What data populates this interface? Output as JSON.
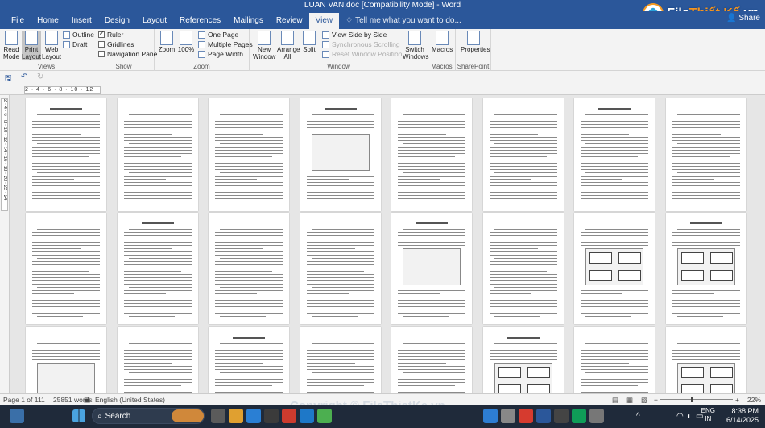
{
  "window": {
    "title": "LUAN VAN.doc [Compatibility Mode] - Word"
  },
  "brand": {
    "name_part1": "File",
    "name_part2": "Thiết Kế",
    "name_part3": ".vn"
  },
  "tabs": [
    "File",
    "Home",
    "Insert",
    "Design",
    "Layout",
    "References",
    "Mailings",
    "Review",
    "View"
  ],
  "tell_me": "Tell me what you want to do...",
  "share_label": "Share",
  "ribbon": {
    "views": {
      "group": "Views",
      "read_mode": "Read Mode",
      "print_layout": "Print Layout",
      "web_layout": "Web Layout",
      "outline": "Outline",
      "draft": "Draft"
    },
    "show": {
      "group": "Show",
      "ruler": "Ruler",
      "gridlines": "Gridlines",
      "nav_pane": "Navigation Pane",
      "ruler_checked": true,
      "gridlines_checked": false,
      "nav_checked": false
    },
    "zoom": {
      "group": "Zoom",
      "zoom": "Zoom",
      "hundred": "100%",
      "one_page": "One Page",
      "multiple_pages": "Multiple Pages",
      "page_width": "Page Width"
    },
    "window": {
      "group": "Window",
      "new_window": "New Window",
      "arrange_all": "Arrange All",
      "split": "Split",
      "side_by_side": "View Side by Side",
      "sync_scroll": "Synchronous Scrolling",
      "reset_pos": "Reset Window Position",
      "switch_windows": "Switch Windows"
    },
    "macros": {
      "group": "Macros",
      "macros": "Macros"
    },
    "sharepoint": {
      "group": "SharePoint",
      "properties": "Properties"
    }
  },
  "ruler_text": "2 · 4 · 6 · 8 · 10 · 12 · 14",
  "vruler_text": "2 · 4 · 6 · 8 · 10 · 12 · 14 · 16 · 18 · 20 · 22 · 24",
  "status": {
    "page": "Page 1 of 111",
    "words": "25851 words",
    "language": "English (United States)",
    "zoom": "22%"
  },
  "taskbar": {
    "search_label": "Search",
    "lang1": "ENG",
    "lang2": "IN",
    "time": "8:38 PM",
    "date": "6/14/2025"
  },
  "watermark": "Copyright © FileThietKe.vn"
}
